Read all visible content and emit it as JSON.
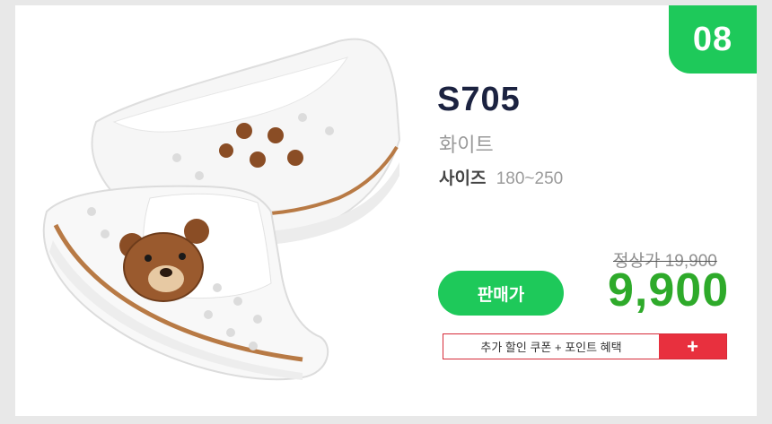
{
  "badge": {
    "number": "08"
  },
  "product": {
    "model": "S705",
    "color": "화이트",
    "size_label": "사이즈",
    "size_range": "180~250",
    "image_icon": "bear-slip-on-shoes-image"
  },
  "pricing": {
    "regular_text": "정상가 19,900",
    "sale_button_label": "판매가",
    "sale_price": "9,900"
  },
  "coupon": {
    "text": "추가 할인 쿠폰 + 포인트 혜택",
    "plus_symbol": "+"
  },
  "colors": {
    "accent_green": "#1ec95a",
    "price_green": "#2eaa2a",
    "coupon_red": "#e8303e",
    "title_navy": "#1b2240"
  }
}
